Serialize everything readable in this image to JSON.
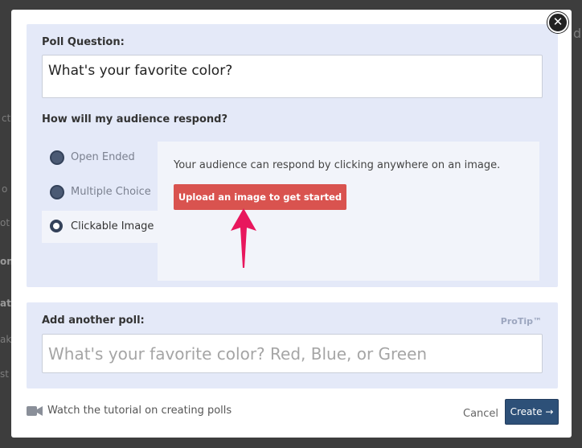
{
  "modal": {
    "poll_question_label": "Poll Question:",
    "poll_question_value": "What's your favorite color?",
    "respond_label": "How will my audience respond?",
    "options": [
      {
        "label": "Open Ended"
      },
      {
        "label": "Multiple Choice"
      },
      {
        "label": "Clickable Image"
      }
    ],
    "selected_option": "Clickable Image",
    "response_text": "Your audience can respond by clicking anywhere on an image.",
    "upload_button": "Upload an image to get started",
    "another_poll_label": "Add another poll:",
    "protip": "ProTip™",
    "another_poll_placeholder": "What's your favorite color? Red, Blue, or Green",
    "tutorial_link": "Watch the tutorial on creating polls",
    "cancel": "Cancel",
    "create": "Create",
    "create_arrow": "→",
    "close_glyph": "✕"
  },
  "background": {
    "fragments": [
      "ct",
      "d",
      "o",
      "on",
      "ot",
      "at",
      "ak",
      "st"
    ]
  },
  "colors": {
    "panel": "#e4e9f8",
    "upload_button": "#d9534f",
    "create_button": "#2d5078",
    "annotation_arrow": "#e8175d"
  }
}
